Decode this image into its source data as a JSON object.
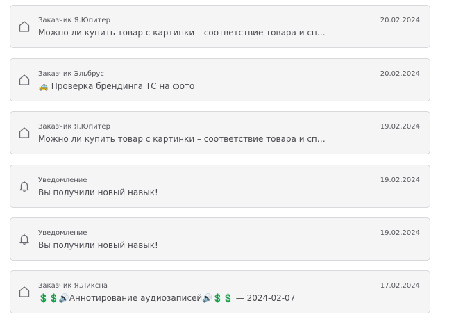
{
  "messages": [
    {
      "sender": "Заказчик Я.Юпитер",
      "date": "20.02.2024",
      "text": "Можно ли купить товар с картинки – соответствие товара и способы доставки",
      "icon": "house-icon"
    },
    {
      "sender": "Заказчик Эльбрус",
      "date": "20.02.2024",
      "text": "🚕 Проверка брендинга ТС на фото",
      "icon": "house-icon"
    },
    {
      "sender": "Заказчик Я.Юпитер",
      "date": "19.02.2024",
      "text": "Можно ли купить товар с картинки – соответствие товара и способы доставки",
      "icon": "house-icon"
    },
    {
      "sender": "Уведомление",
      "date": "19.02.2024",
      "text": "Вы получили новый навык!",
      "icon": "bell-icon"
    },
    {
      "sender": "Уведомление",
      "date": "19.02.2024",
      "text": "Вы получили новый навык!",
      "icon": "bell-icon"
    },
    {
      "sender": "Заказчик Я.Ликсна",
      "date": "17.02.2024",
      "text": "💲💲🔊Аннотирование аудиозаписей🔊💲💲 — 2024-02-07",
      "icon": "house-icon"
    }
  ],
  "colors": {
    "card_background": "#f5f5f6",
    "card_border": "#d9d9dd",
    "text": "#4a4a4f",
    "meta": "#55555a"
  }
}
